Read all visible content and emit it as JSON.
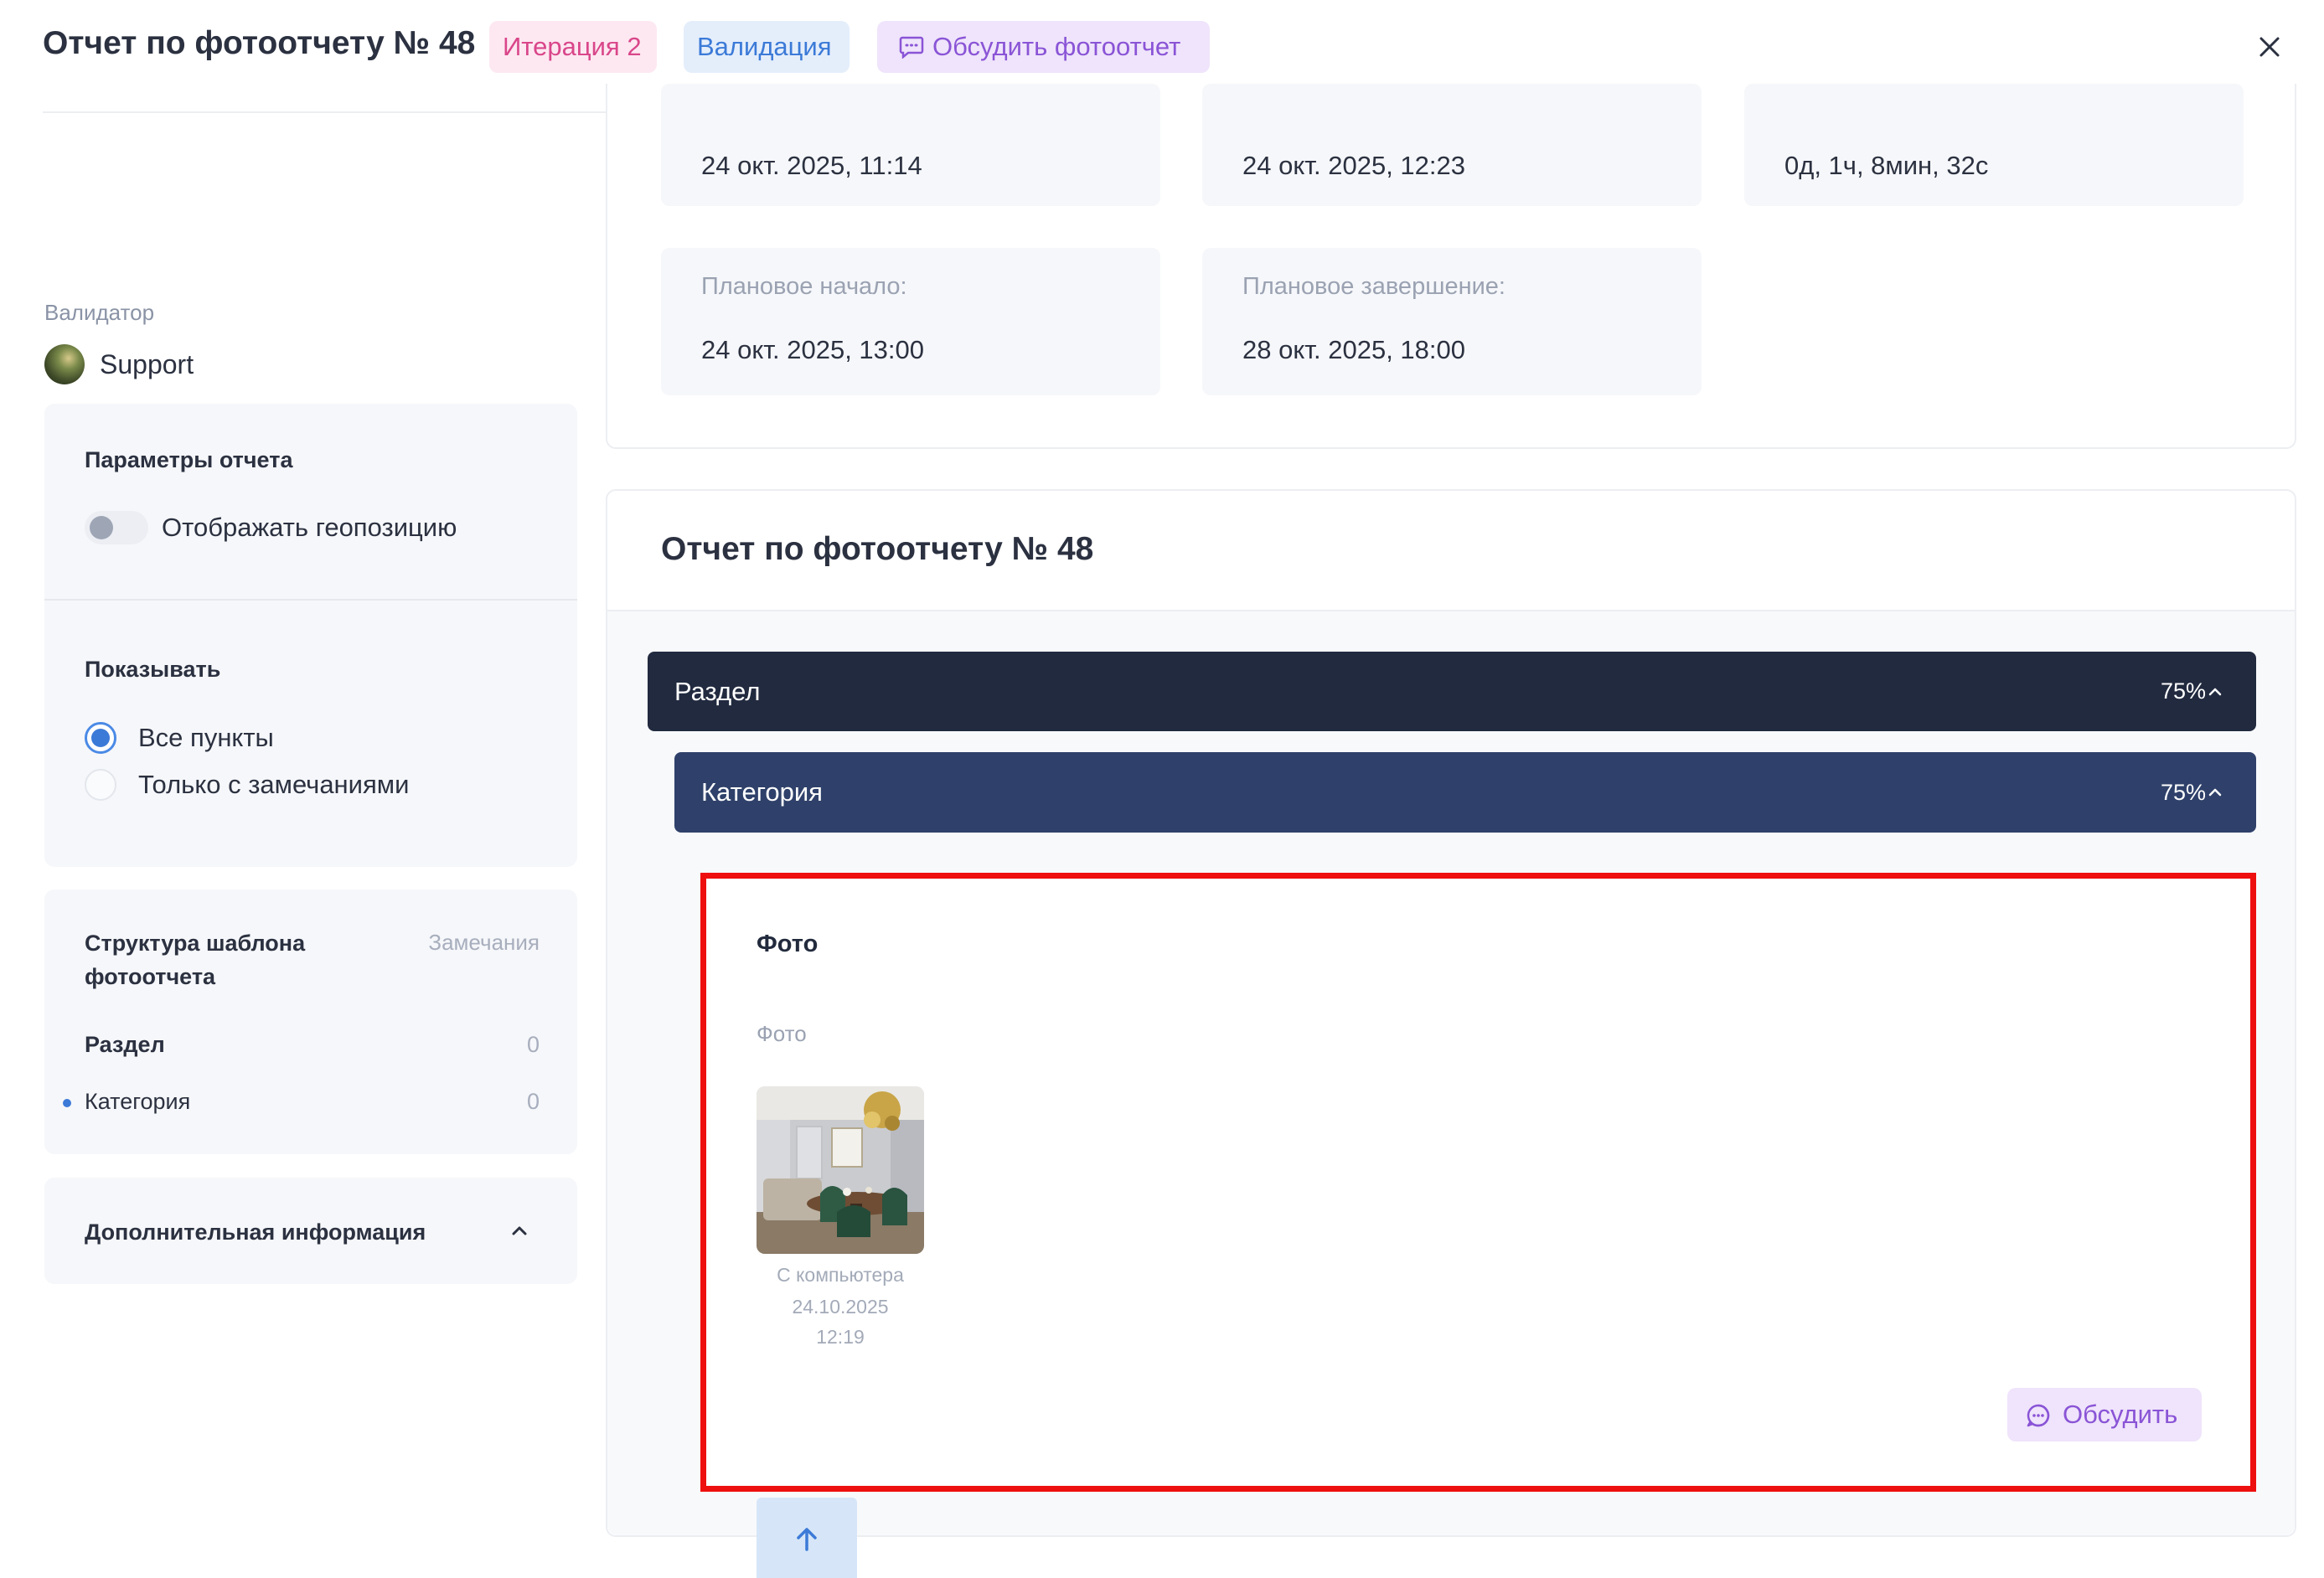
{
  "header": {
    "title": "Отчет по фотоотчету № 48",
    "iteration_tag": "Итерация 2",
    "status_tag": "Валидация",
    "discuss_button": "Обсудить фотоотчет"
  },
  "sidebar": {
    "validator_label": "Валидатор",
    "validator_name": "Support",
    "params": {
      "title": "Параметры отчета",
      "geo_toggle_label": "Отображать геопозицию",
      "geo_toggle_on": false
    },
    "show": {
      "title": "Показывать",
      "options": [
        {
          "label": "Все пункты",
          "selected": true
        },
        {
          "label": "Только с замечаниями",
          "selected": false
        }
      ]
    },
    "structure": {
      "title": "Структура шаблона фотоотчета",
      "notes_header": "Замечания",
      "rows": [
        {
          "label": "Раздел",
          "count": "0"
        },
        {
          "label": "Категория",
          "count": "0"
        }
      ]
    },
    "additional": {
      "title": "Дополнительная информация"
    }
  },
  "info_cards": [
    {
      "value": "24 окт. 2025, 11:14"
    },
    {
      "value": "24 окт. 2025, 12:23"
    },
    {
      "value": "0д, 1ч, 8мин, 32с"
    },
    {
      "label": "Плановое начало:",
      "value": "24 окт. 2025, 13:00"
    },
    {
      "label": "Плановое завершение:",
      "value": "28 окт. 2025, 18:00"
    }
  ],
  "report": {
    "title": "Отчет по фотоотчету № 48",
    "section": {
      "label": "Раздел",
      "percent": "75%"
    },
    "category": {
      "label": "Категория",
      "percent": "75%"
    },
    "photo_item": {
      "title": "Фото",
      "subtitle": "Фото",
      "source": "С компьютера",
      "date": "24.10.2025",
      "time": "12:19",
      "discuss_label": "Обсудить"
    }
  },
  "colors": {
    "section_bar": "#212a3f",
    "category_bar": "#2f416a",
    "accent_blue": "#3b7ad7",
    "highlight_border": "#ee0f0f",
    "discuss_bg": "#efe4fb",
    "discuss_text": "#8a54d6"
  }
}
